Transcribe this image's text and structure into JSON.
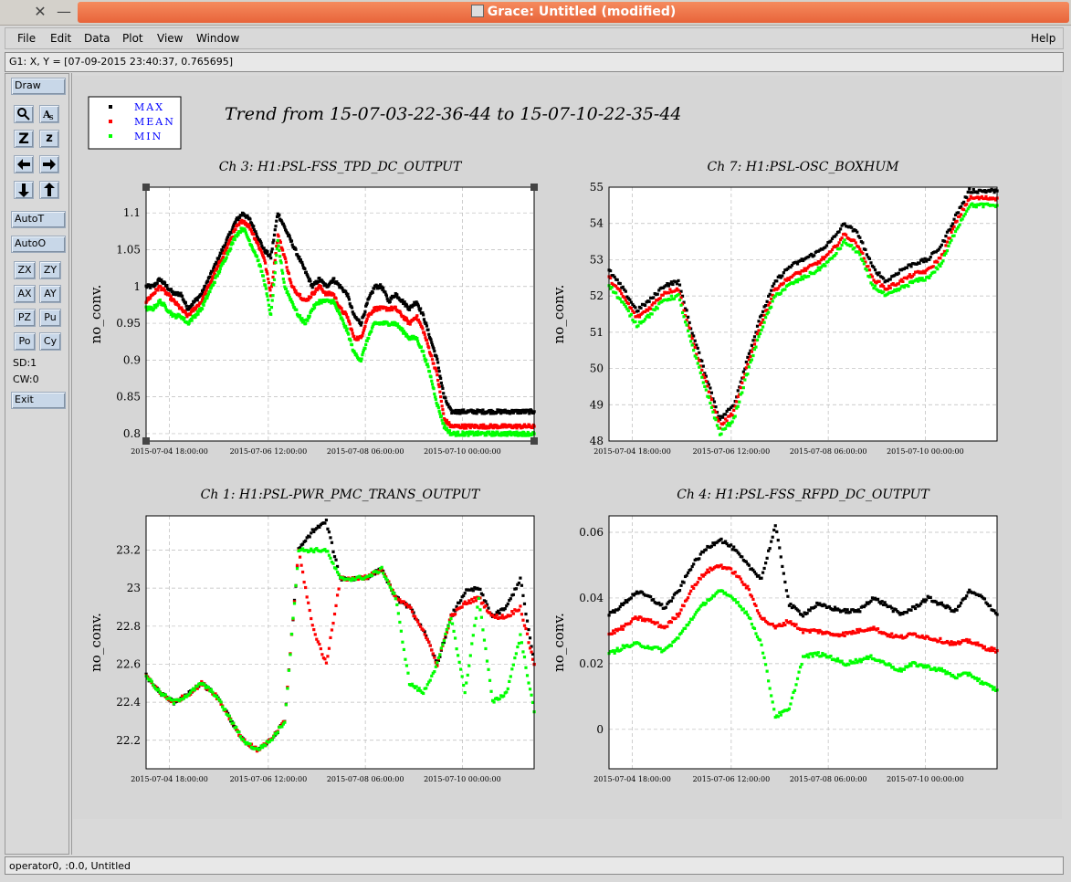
{
  "window": {
    "title": "Grace: Untitled (modified)",
    "close_glyph": "✕",
    "min_glyph": "—",
    "max_glyph": "☐"
  },
  "menu": {
    "file": "File",
    "edit": "Edit",
    "data": "Data",
    "plot": "Plot",
    "view": "View",
    "window": "Window",
    "help": "Help"
  },
  "locator": "G1: X, Y = [07-09-2015 23:40:37, 0.765695]",
  "tools": {
    "draw": "Draw",
    "zoom_icon": "magnifier-icon",
    "autoscale_icon": "text-as-icon",
    "z_big": "Z",
    "z_small": "z",
    "autot": "AutoT",
    "autoo": "AutoO",
    "zx": "ZX",
    "zy": "ZY",
    "ax": "AX",
    "ay": "AY",
    "pz": "PZ",
    "pu": "Pu",
    "po": "Po",
    "cy": "Cy",
    "sd": "SD:1",
    "cw": "CW:0",
    "exit": "Exit"
  },
  "status": "operator0, :0.0, Untitled",
  "colors": {
    "max": "#000000",
    "mean": "#ff0000",
    "min": "#00ff00",
    "legend_text": "#0000ff",
    "title_bar": "#e8643a"
  },
  "main_title": "Trend from 15-07-03-22-36-44 to 15-07-10-22-35-44",
  "legend": [
    "MAX",
    "MEAN",
    "MIN"
  ],
  "x_ticks": [
    "2015-07-04 18:00:00",
    "2015-07-06 12:00:00",
    "2015-07-08 06:00:00",
    "2015-07-10 00:00:00"
  ],
  "chart_data": [
    {
      "type": "scatter",
      "title": "Ch 3: H1:PSL-FSS_TPD_DC_OUTPUT",
      "ylabel": "no_conv.",
      "ylim": [
        0.79,
        1.135
      ],
      "yticks": [
        "0.8",
        "0.85",
        "0.9",
        "0.95",
        "1",
        "1.05",
        "1.1"
      ],
      "ytick_values": [
        0.8,
        0.85,
        0.9,
        0.95,
        1.0,
        1.05,
        1.1
      ],
      "x": [
        0,
        3,
        6,
        9,
        12,
        15,
        18,
        21,
        24,
        27,
        30,
        33,
        36,
        39,
        42,
        45,
        48,
        51,
        54,
        57,
        60,
        63,
        66,
        69,
        72,
        75,
        78,
        81,
        84,
        87,
        90,
        93,
        96,
        99,
        102,
        105,
        108,
        111,
        114,
        117,
        120,
        123,
        126,
        129,
        132,
        135,
        138,
        141,
        144,
        147,
        150,
        153,
        156,
        159,
        162,
        165,
        168
      ],
      "series": [
        {
          "name": "MAX",
          "values": [
            1.0,
            1.0,
            1.01,
            1.0,
            0.99,
            0.99,
            0.97,
            0.98,
            0.99,
            1.01,
            1.03,
            1.05,
            1.07,
            1.09,
            1.1,
            1.09,
            1.07,
            1.05,
            1.04,
            1.1,
            1.08,
            1.06,
            1.04,
            1.02,
            1.0,
            1.01,
            1.0,
            1.01,
            1.0,
            0.99,
            0.96,
            0.95,
            0.98,
            1.0,
            1.0,
            0.98,
            0.99,
            0.98,
            0.97,
            0.98,
            0.96,
            0.93,
            0.9,
            0.85,
            0.83,
            0.83,
            0.83,
            0.83,
            0.83,
            0.83,
            0.83,
            0.83,
            0.83,
            0.83,
            0.83,
            0.83,
            0.83
          ]
        },
        {
          "name": "MEAN",
          "values": [
            0.98,
            0.99,
            1.0,
            0.99,
            0.98,
            0.97,
            0.96,
            0.97,
            0.98,
            1.0,
            1.02,
            1.04,
            1.06,
            1.08,
            1.09,
            1.08,
            1.06,
            1.04,
            0.99,
            1.07,
            1.04,
            1.0,
            0.99,
            0.98,
            0.99,
            1.0,
            0.99,
            0.99,
            0.97,
            0.96,
            0.93,
            0.93,
            0.96,
            0.97,
            0.97,
            0.97,
            0.97,
            0.96,
            0.95,
            0.96,
            0.94,
            0.91,
            0.88,
            0.82,
            0.81,
            0.81,
            0.81,
            0.81,
            0.81,
            0.81,
            0.81,
            0.81,
            0.81,
            0.81,
            0.81,
            0.81,
            0.81
          ]
        },
        {
          "name": "MIN",
          "values": [
            0.97,
            0.97,
            0.98,
            0.97,
            0.96,
            0.96,
            0.95,
            0.96,
            0.97,
            0.99,
            1.01,
            1.03,
            1.05,
            1.07,
            1.08,
            1.06,
            1.04,
            1.01,
            0.96,
            1.06,
            1.0,
            0.98,
            0.96,
            0.95,
            0.97,
            0.98,
            0.98,
            0.98,
            0.96,
            0.94,
            0.91,
            0.9,
            0.93,
            0.95,
            0.95,
            0.95,
            0.95,
            0.94,
            0.93,
            0.93,
            0.91,
            0.88,
            0.84,
            0.81,
            0.8,
            0.8,
            0.8,
            0.8,
            0.8,
            0.8,
            0.8,
            0.8,
            0.8,
            0.8,
            0.8,
            0.8,
            0.8
          ]
        }
      ]
    },
    {
      "type": "scatter",
      "title": "Ch 7: H1:PSL-OSC_BOXHUM",
      "ylabel": "no_conv.",
      "ylim": [
        48,
        55
      ],
      "yticks": [
        "48",
        "49",
        "50",
        "51",
        "52",
        "53",
        "54",
        "55"
      ],
      "ytick_values": [
        48,
        49,
        50,
        51,
        52,
        53,
        54,
        55
      ],
      "x": [
        0,
        6,
        12,
        18,
        24,
        30,
        36,
        42,
        48,
        54,
        60,
        66,
        72,
        78,
        84,
        90,
        96,
        102,
        108,
        114,
        120,
        126,
        132,
        138,
        144,
        150,
        156,
        162,
        168
      ],
      "series": [
        {
          "name": "MAX",
          "values": [
            52.7,
            52.2,
            51.6,
            51.9,
            52.3,
            52.4,
            51.0,
            49.8,
            48.6,
            49.0,
            50.3,
            51.5,
            52.4,
            52.8,
            53.0,
            53.2,
            53.5,
            54.0,
            53.7,
            52.8,
            52.4,
            52.7,
            52.9,
            53.0,
            53.4,
            54.2,
            54.9,
            54.9,
            54.9
          ]
        },
        {
          "name": "MEAN",
          "values": [
            52.5,
            52.0,
            51.4,
            51.7,
            52.1,
            52.2,
            50.8,
            49.6,
            48.4,
            48.8,
            50.1,
            51.3,
            52.2,
            52.5,
            52.7,
            52.9,
            53.2,
            53.7,
            53.4,
            52.5,
            52.2,
            52.4,
            52.6,
            52.7,
            53.1,
            54.0,
            54.7,
            54.7,
            54.7
          ]
        },
        {
          "name": "MIN",
          "values": [
            52.3,
            51.8,
            51.2,
            51.5,
            51.9,
            52.0,
            50.6,
            49.4,
            48.2,
            48.6,
            49.9,
            51.1,
            52.0,
            52.3,
            52.5,
            52.7,
            53.0,
            53.5,
            53.2,
            52.3,
            52.0,
            52.2,
            52.4,
            52.5,
            52.9,
            53.8,
            54.5,
            54.5,
            54.5
          ]
        }
      ]
    },
    {
      "type": "scatter",
      "title": "Ch 1: H1:PSL-PWR_PMC_TRANS_OUTPUT",
      "ylabel": "no_conv.",
      "ylim": [
        22.05,
        23.38
      ],
      "yticks": [
        "22.2",
        "22.4",
        "22.6",
        "22.8",
        "23",
        "23.2"
      ],
      "ytick_values": [
        22.2,
        22.4,
        22.6,
        22.8,
        23.0,
        23.2
      ],
      "x": [
        0,
        6,
        12,
        18,
        24,
        30,
        36,
        42,
        48,
        54,
        60,
        66,
        72,
        78,
        84,
        90,
        96,
        102,
        108,
        114,
        120,
        126,
        132,
        138,
        144,
        150,
        156,
        162,
        168
      ],
      "series": [
        {
          "name": "MAX",
          "values": [
            22.54,
            22.45,
            22.4,
            22.44,
            22.5,
            22.44,
            22.32,
            22.2,
            22.15,
            22.2,
            22.3,
            23.2,
            23.3,
            23.35,
            23.05,
            23.05,
            23.06,
            23.1,
            22.95,
            22.9,
            22.78,
            22.6,
            22.85,
            22.98,
            23.0,
            22.85,
            22.9,
            23.05,
            22.6
          ]
        },
        {
          "name": "MEAN",
          "values": [
            22.54,
            22.45,
            22.4,
            22.44,
            22.5,
            22.44,
            22.32,
            22.2,
            22.15,
            22.2,
            22.3,
            23.2,
            22.8,
            22.6,
            23.05,
            23.05,
            23.06,
            23.1,
            22.95,
            22.9,
            22.78,
            22.6,
            22.85,
            22.92,
            22.95,
            22.85,
            22.85,
            22.9,
            22.6
          ]
        },
        {
          "name": "MIN",
          "values": [
            22.54,
            22.45,
            22.4,
            22.44,
            22.5,
            22.44,
            22.32,
            22.2,
            22.15,
            22.2,
            22.3,
            23.2,
            23.2,
            23.2,
            23.05,
            23.05,
            23.06,
            23.1,
            22.95,
            22.5,
            22.45,
            22.6,
            22.85,
            22.45,
            22.95,
            22.4,
            22.45,
            22.75,
            22.35
          ]
        }
      ]
    },
    {
      "type": "scatter",
      "title": "Ch 4: H1:PSL-FSS_RFPD_DC_OUTPUT",
      "ylabel": "no_conv.",
      "ylim": [
        -0.012,
        0.065
      ],
      "yticks": [
        "0",
        "0.02",
        "0.04",
        "0.06"
      ],
      "ytick_values": [
        0,
        0.02,
        0.04,
        0.06
      ],
      "x": [
        0,
        6,
        12,
        18,
        24,
        30,
        36,
        42,
        48,
        54,
        60,
        66,
        72,
        78,
        84,
        90,
        96,
        102,
        108,
        114,
        120,
        126,
        132,
        138,
        144,
        150,
        156,
        162,
        168
      ],
      "series": [
        {
          "name": "MAX",
          "values": [
            0.035,
            0.038,
            0.042,
            0.04,
            0.037,
            0.042,
            0.05,
            0.055,
            0.058,
            0.055,
            0.05,
            0.046,
            0.062,
            0.038,
            0.035,
            0.038,
            0.037,
            0.036,
            0.036,
            0.04,
            0.038,
            0.035,
            0.037,
            0.04,
            0.038,
            0.036,
            0.042,
            0.04,
            0.035
          ]
        },
        {
          "name": "MEAN",
          "values": [
            0.029,
            0.031,
            0.034,
            0.033,
            0.031,
            0.035,
            0.043,
            0.048,
            0.05,
            0.048,
            0.043,
            0.034,
            0.031,
            0.033,
            0.03,
            0.03,
            0.029,
            0.029,
            0.03,
            0.031,
            0.029,
            0.028,
            0.029,
            0.028,
            0.027,
            0.026,
            0.027,
            0.025,
            0.024
          ]
        },
        {
          "name": "MIN",
          "values": [
            0.023,
            0.025,
            0.026,
            0.025,
            0.024,
            0.028,
            0.034,
            0.039,
            0.042,
            0.04,
            0.035,
            0.026,
            0.004,
            0.006,
            0.022,
            0.023,
            0.022,
            0.02,
            0.021,
            0.022,
            0.02,
            0.018,
            0.02,
            0.019,
            0.018,
            0.016,
            0.017,
            0.014,
            0.012
          ]
        }
      ]
    }
  ]
}
